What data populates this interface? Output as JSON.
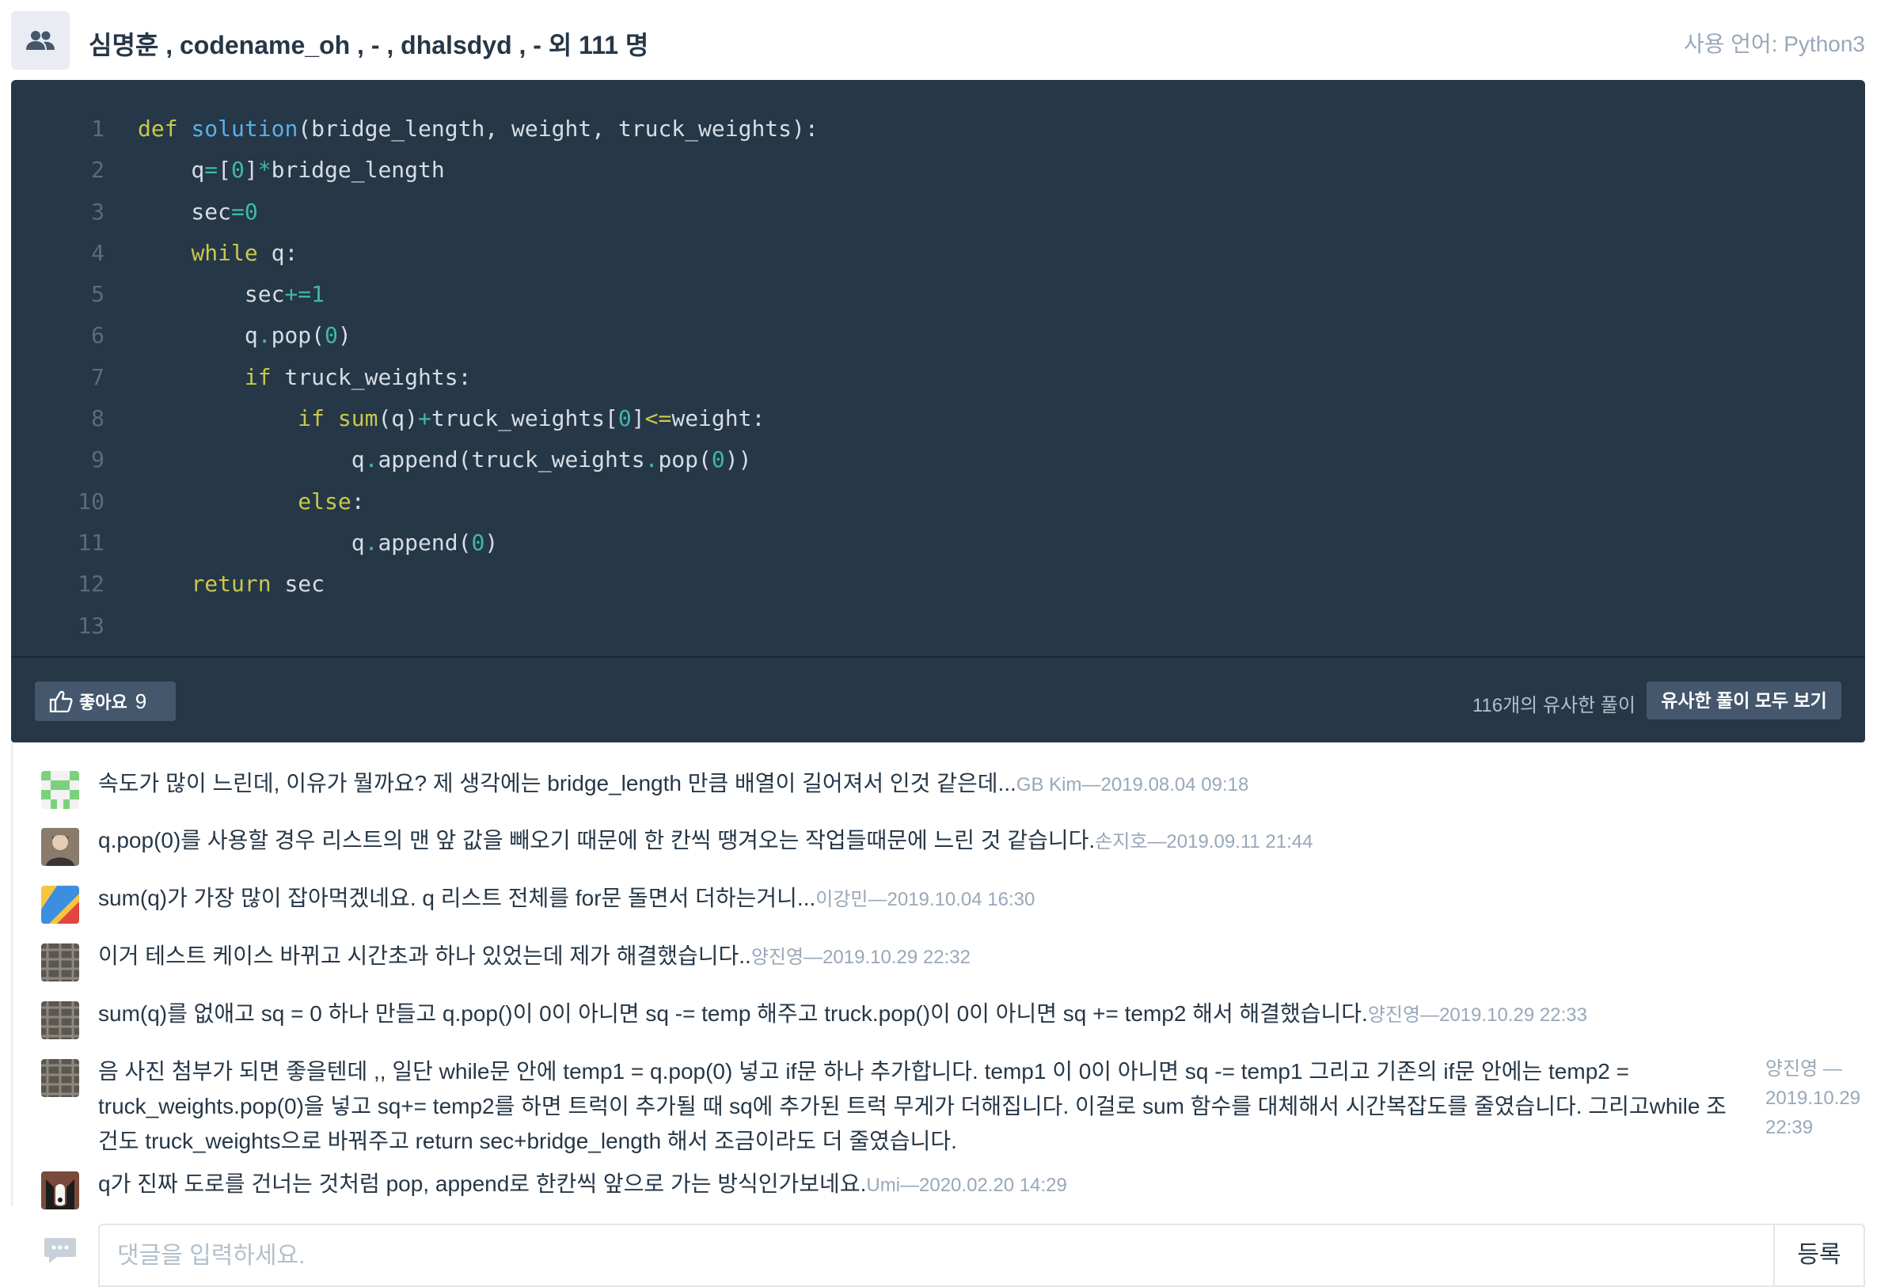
{
  "header": {
    "authors": "심명훈 , codename_oh , - , dhalsdyd , - 외 111 명",
    "language": "사용 언어: Python3"
  },
  "code": {
    "line_numbers": [
      "1",
      "2",
      "3",
      "4",
      "5",
      "6",
      "7",
      "8",
      "9",
      "10",
      "11",
      "12",
      "13"
    ]
  },
  "footer": {
    "like_label": "좋아요",
    "like_count": "9",
    "similar_count": "116개의 유사한 풀이",
    "similar_button": "유사한 풀이 모두 보기"
  },
  "comments": [
    {
      "text": "속도가 많이 느린데, 이유가 뭘까요? 제 생각에는 bridge_length 만큼 배열이 길어져서 인것 같은데...",
      "meta": "GB Kim—2019.08.04 09:18"
    },
    {
      "text": "q.pop(0)를 사용할 경우 리스트의 맨 앞 값을 빼오기 때문에 한 칸씩 땡겨오는 작업들때문에 느린 것 같습니다.",
      "meta": "손지호—2019.09.11 21:44"
    },
    {
      "text": "sum(q)가 가장 많이 잡아먹겠네요. q 리스트 전체를 for문 돌면서 더하는거니...",
      "meta": "이강민—2019.10.04 16:30"
    },
    {
      "text": "이거 테스트 케이스 바뀌고 시간초과 하나 있었는데 제가 해결했습니다..",
      "meta": "양진영—2019.10.29 22:32"
    },
    {
      "text": "sum(q)를 없애고 sq = 0 하나 만들고 q.pop()이 0이 아니면 sq -= temp 해주고 truck.pop()이 0이 아니면 sq += temp2 해서 해결했습니다.",
      "meta": "양진영—2019.10.29 22:33"
    },
    {
      "text": "음 사진 첨부가 되면 좋을텐데 ,, 일단 while문 안에 temp1 = q.pop(0) 넣고 if문 하나 추가합니다. temp1 이 0이 아니면 sq -= temp1 그리고 기존의 if문 안에는 temp2 = truck_weights.pop(0)을 넣고 sq+= temp2를 하면 트럭이 추가될 때 sq에 추가된 트럭 무게가 더해집니다. 이걸로 sum 함수를 대체해서 시간복잡도를 줄였습니다. 그리고while 조건도 truck_weights으로 바꿔주고 return sec+bridge_length 해서 조금이라도 더 줄였습니다.",
      "meta": "양진영 —2019.10.29 22:39"
    },
    {
      "text": "q가 진짜 도로를 건너는 것처럼 pop, append로 한칸씩 앞으로 가는 방식인가보네요.",
      "meta": "Umi—2020.02.20 14:29"
    }
  ],
  "input": {
    "placeholder": "댓글을 입력하세요.",
    "submit": "등록"
  },
  "colors": {
    "code_bg": "#263747",
    "keyword": "#c8c84a",
    "function": "#5aaee6",
    "number": "#3fb8a8",
    "meta_text": "#98a8b9"
  }
}
